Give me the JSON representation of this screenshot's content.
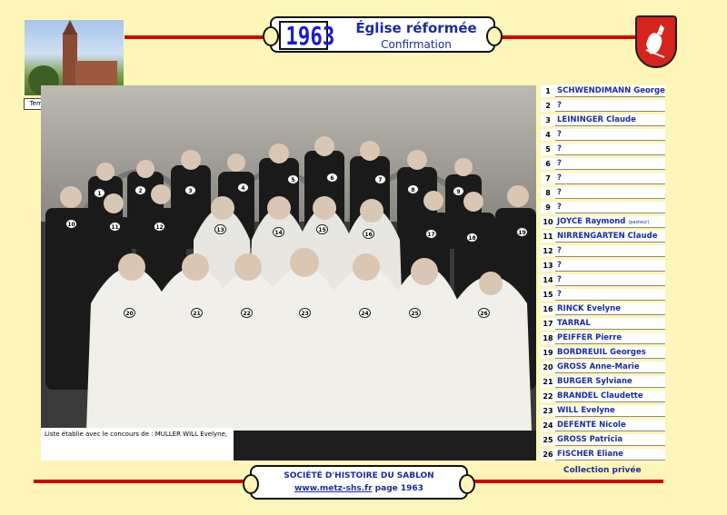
{
  "header": {
    "year": "1963",
    "title": "Église réformée",
    "subtitle": "Confirmation"
  },
  "thumbnail": {
    "caption": "Temple de Montigny-Sablon"
  },
  "photo": {
    "credit": "Liste établie avec le concours de : MULLER WILL Evelyne,",
    "badges": [
      "1",
      "2",
      "3",
      "4",
      "5",
      "6",
      "7",
      "8",
      "9",
      "10",
      "11",
      "12",
      "13",
      "14",
      "15",
      "16",
      "17",
      "18",
      "19",
      "20",
      "21",
      "22",
      "23",
      "24",
      "25",
      "26"
    ]
  },
  "names": [
    {
      "num": "1",
      "name": "SCHWENDIMANN Georges",
      "note": ""
    },
    {
      "num": "2",
      "name": "?",
      "note": ""
    },
    {
      "num": "3",
      "name": "LEININGER Claude",
      "note": ""
    },
    {
      "num": "4",
      "name": "?",
      "note": ""
    },
    {
      "num": "5",
      "name": "?",
      "note": ""
    },
    {
      "num": "6",
      "name": "?",
      "note": ""
    },
    {
      "num": "7",
      "name": "?",
      "note": ""
    },
    {
      "num": "8",
      "name": "?",
      "note": ""
    },
    {
      "num": "9",
      "name": "?",
      "note": ""
    },
    {
      "num": "10",
      "name": "JOYCE Raymond",
      "note": "(pasteur)"
    },
    {
      "num": "11",
      "name": "NIRRENGARTEN Claude",
      "note": ""
    },
    {
      "num": "12",
      "name": "?",
      "note": ""
    },
    {
      "num": "13",
      "name": "?",
      "note": ""
    },
    {
      "num": "14",
      "name": "?",
      "note": ""
    },
    {
      "num": "15",
      "name": "?",
      "note": ""
    },
    {
      "num": "16",
      "name": "RINCK Evelyne",
      "note": ""
    },
    {
      "num": "17",
      "name": "TARRAL",
      "note": ""
    },
    {
      "num": "18",
      "name": "PEIFFER Pierre",
      "note": ""
    },
    {
      "num": "19",
      "name": "BORDREUIL Georges",
      "note": ""
    },
    {
      "num": "20",
      "name": "GROSS Anne-Marie",
      "note": ""
    },
    {
      "num": "21",
      "name": "BURGER Sylviane",
      "note": ""
    },
    {
      "num": "22",
      "name": "BRANDEL Claudette",
      "note": ""
    },
    {
      "num": "23",
      "name": "WILL Evelyne",
      "note": ""
    },
    {
      "num": "24",
      "name": "DEFENTE Nicole",
      "note": ""
    },
    {
      "num": "25",
      "name": "GROSS Patricia",
      "note": ""
    },
    {
      "num": "26",
      "name": "FISCHER Eliane",
      "note": ""
    }
  ],
  "collection": "Collection privée",
  "footer": {
    "society": "SOCIÉTÉ D'HISTOIRE DU SABLON",
    "site": "www.metz-shs.fr",
    "page": "page 1963"
  },
  "colors": {
    "background": "#fdf6b8",
    "accent_red": "#d40000",
    "text_blue": "#1b2d9a",
    "year_blue": "#1b1bd0"
  }
}
